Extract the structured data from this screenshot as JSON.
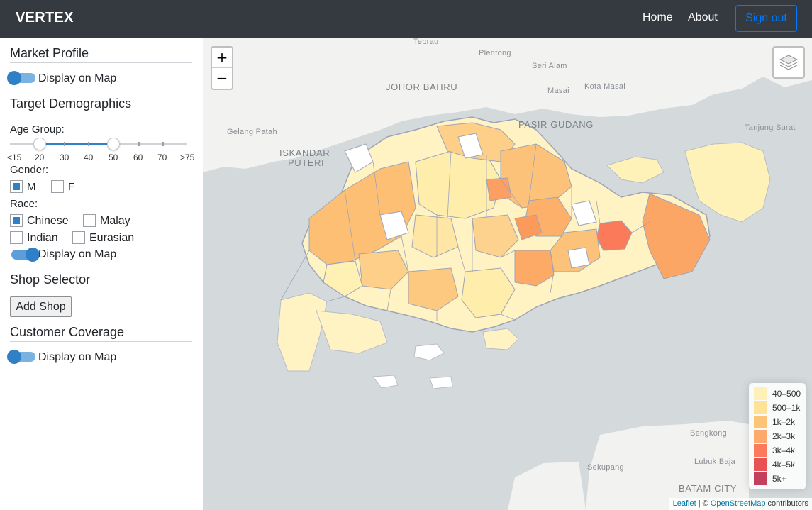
{
  "navbar": {
    "brand": "VERTEX",
    "links": [
      "Home",
      "About"
    ],
    "signout_label": "Sign out",
    "signout_color": "#007bff"
  },
  "sidebar": {
    "market_profile": {
      "title": "Market Profile",
      "toggle_label": "Display on Map",
      "toggle_on": false
    },
    "target_demographics": {
      "title": "Target Demographics",
      "age_label": "Age Group:",
      "age_ticks": [
        "<15",
        "20",
        "30",
        "40",
        "50",
        "60",
        "70",
        ">75"
      ],
      "age_range": [
        "20",
        "50"
      ],
      "gender_label": "Gender:",
      "gender_options": [
        {
          "label": "M",
          "checked": true
        },
        {
          "label": "F",
          "checked": false
        }
      ],
      "race_label": "Race:",
      "race_options": [
        {
          "label": "Chinese",
          "checked": true
        },
        {
          "label": "Malay",
          "checked": false
        },
        {
          "label": "Indian",
          "checked": false
        },
        {
          "label": "Eurasian",
          "checked": false
        }
      ],
      "toggle_label": "Display on Map",
      "toggle_on": true
    },
    "shop_selector": {
      "title": "Shop Selector",
      "button_label": "Add Shop"
    },
    "customer_coverage": {
      "title": "Customer Coverage",
      "toggle_label": "Display on Map",
      "toggle_on": false
    }
  },
  "map": {
    "zoom_in": "+",
    "zoom_out": "−",
    "labels": {
      "tebrau": "Tebrau",
      "plentong": "Plentong",
      "seri_alam": "Seri Alam",
      "johor_bahru": "JOHOR BAHRU",
      "masai": "Masai",
      "kota_masai": "Kota Masai",
      "pasir_gudang": "PASIR GUDANG",
      "gelang_patah": "Gelang Patah",
      "iskandar": "ISKANDAR",
      "puteri": "PUTERI",
      "tanjung_surat": "Tanjung Surat",
      "bengkong": "Bengkong",
      "sekupang": "Sekupang",
      "lubuk_baja": "Lubuk Baja",
      "batam_city": "BATAM CITY"
    },
    "legend": [
      {
        "label": "40–500",
        "color": "#ffeda0"
      },
      {
        "label": "500–1k",
        "color": "#fed976"
      },
      {
        "label": "1k–2k",
        "color": "#feb24c"
      },
      {
        "label": "2k–3k",
        "color": "#fd8d3c"
      },
      {
        "label": "3k–4k",
        "color": "#fc4e2a"
      },
      {
        "label": "4k–5k",
        "color": "#e31a1c"
      },
      {
        "label": "5k+",
        "color": "#b10026"
      }
    ],
    "attribution": {
      "leaflet": "Leaflet",
      "separator": " | © ",
      "osm": "OpenStreetMap",
      "suffix": " contributors"
    }
  }
}
